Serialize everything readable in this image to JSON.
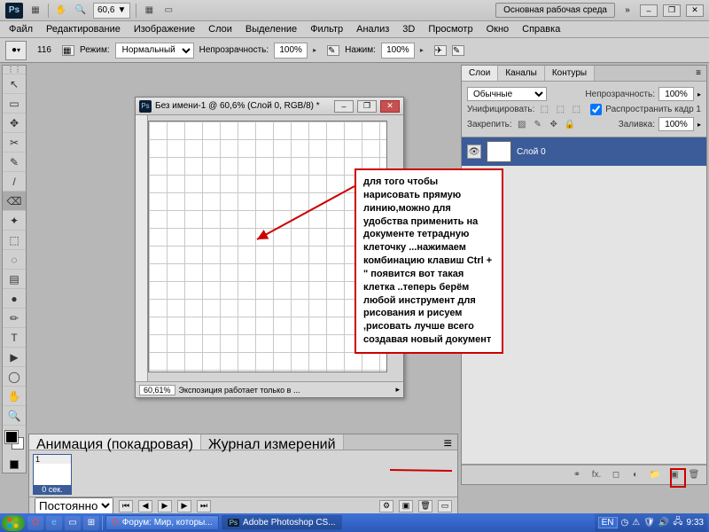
{
  "app": {
    "logo": "Ps",
    "zoom": "60,6",
    "workspace_label": "Основная рабочая среда"
  },
  "menu": [
    "Файл",
    "Редактирование",
    "Изображение",
    "Слои",
    "Выделение",
    "Фильтр",
    "Анализ",
    "3D",
    "Просмотр",
    "Окно",
    "Справка"
  ],
  "options": {
    "brush_size": "116",
    "mode_label": "Режим:",
    "mode_value": "Нормальный",
    "opacity_label": "Непрозрачность:",
    "opacity_value": "100%",
    "flow_label": "Нажим:",
    "flow_value": "100%"
  },
  "tools": [
    "↖",
    "▭",
    "✥",
    "✂",
    "✎",
    "/",
    "⌫",
    "✦",
    "⬚",
    "◌",
    "▤",
    "●",
    "✏",
    "T",
    "▶",
    "◯",
    "✋",
    "🔍"
  ],
  "document": {
    "title": "Без имени-1 @ 60,6% (Слой 0, RGB/8) *",
    "status_zoom": "60,61%",
    "status_text": "Экспозиция работает только в ..."
  },
  "panels": {
    "tabs": [
      "Слои",
      "Каналы",
      "Контуры"
    ],
    "blend_mode": "Обычные",
    "opacity_label": "Непрозрачность:",
    "opacity_value": "100%",
    "unify_label": "Унифицировать:",
    "propagate_label": "Распространить кадр 1",
    "propagate_checked": true,
    "lock_label": "Закрепить:",
    "fill_label": "Заливка:",
    "fill_value": "100%",
    "layer_name": "Слой 0"
  },
  "animation": {
    "tabs": [
      "Анимация (покадровая)",
      "Журнал измерений"
    ],
    "frame_num": "1",
    "frame_caption": "0 сек.",
    "loop": "Постоянно"
  },
  "annotation": "для того чтобы нарисовать прямую линию,можно для удобства применить на документе тетрадную клеточку ...нажимаем комбинацию клавиш Ctrl + \" появится вот такая клетка ..теперь берём любой инструмент для рисования и рисуем ,рисовать лучше всего создавая новый документ",
  "taskbar": {
    "task1": "Форум: Мир, которы...",
    "task2": "Adobe Photoshop CS...",
    "lang": "EN",
    "clock": "9:33"
  }
}
